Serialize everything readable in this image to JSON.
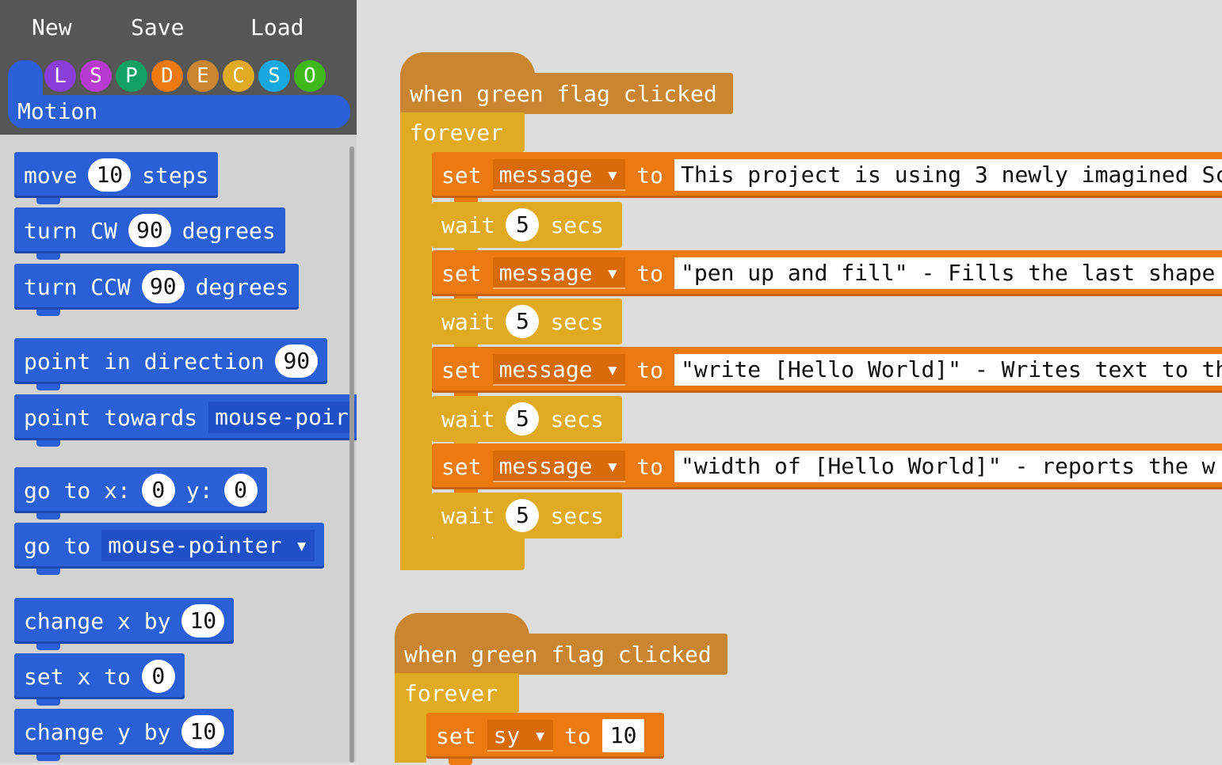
{
  "menu": {
    "new": "New",
    "save": "Save",
    "load": "Load"
  },
  "categories": [
    {
      "letter": "L",
      "color": "#8a3ed8"
    },
    {
      "letter": "S",
      "color": "#b83ad0"
    },
    {
      "letter": "P",
      "color": "#12a064"
    },
    {
      "letter": "D",
      "color": "#ec7a10"
    },
    {
      "letter": "E",
      "color": "#c9852f"
    },
    {
      "letter": "C",
      "color": "#e0aa22"
    },
    {
      "letter": "S",
      "color": "#18a8e0"
    },
    {
      "letter": "O",
      "color": "#3fb81a"
    }
  ],
  "selected_category": "Motion",
  "palette": {
    "move": [
      "move",
      "10",
      "steps"
    ],
    "turn_cw": [
      "turn CW",
      "90",
      "degrees"
    ],
    "turn_ccw": [
      "turn CCW",
      "90",
      "degrees"
    ],
    "point_dir": [
      "point in direction",
      "90"
    ],
    "point_towards": [
      "point towards",
      "mouse-poir"
    ],
    "goto_xy": [
      "go to x:",
      "0",
      "y:",
      "0"
    ],
    "goto": [
      "go to",
      "mouse-pointer ▾"
    ],
    "change_x": [
      "change x by",
      "10"
    ],
    "set_x": [
      "set x to",
      "0"
    ],
    "change_y": [
      "change y by",
      "10"
    ]
  },
  "script1": {
    "hat": "when green flag clicked",
    "forever": "forever",
    "set_label": "set",
    "var": "message ▾",
    "to": "to",
    "messages": [
      "This project is using 3 newly imagined Scr",
      "\"pen up and fill\" - Fills the last shape",
      "\"write [Hello World]\" - Writes text to th",
      "\"width of [Hello World]\" - reports the w"
    ],
    "wait": "wait",
    "wait_value": "5",
    "secs": "secs"
  },
  "script2": {
    "hat": "when green flag clicked",
    "forever": "forever",
    "set_label": "set",
    "var": "sy ▾",
    "to": "to",
    "value": "10"
  }
}
